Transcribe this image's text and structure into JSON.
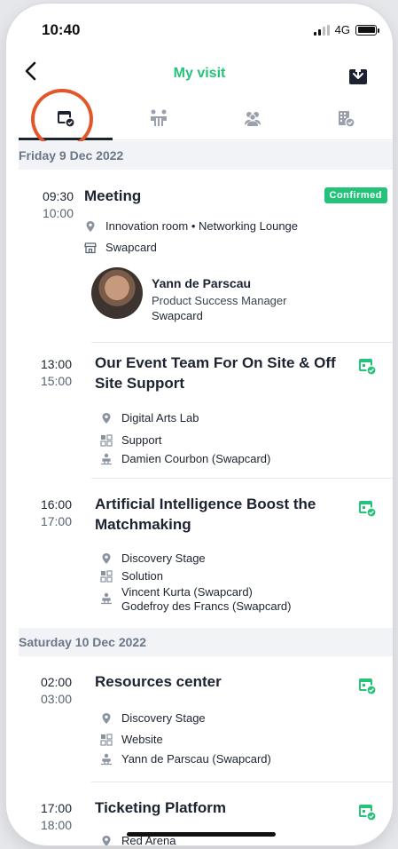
{
  "status": {
    "time": "10:40",
    "network": "4G"
  },
  "header": {
    "title": "My visit"
  },
  "colors": {
    "accent": "#23c37a",
    "highlight": "#e2562a"
  },
  "tabs": [
    {
      "icon": "calendar-check-icon",
      "active": true
    },
    {
      "icon": "meeting-table-icon",
      "active": false
    },
    {
      "icon": "people-icon",
      "active": false
    },
    {
      "icon": "building-check-icon",
      "active": false
    }
  ],
  "days": [
    {
      "label": "Friday 9 Dec 2022",
      "sessions": [
        {
          "start": "09:30",
          "end": "10:00",
          "title": "Meeting",
          "badge": "Confirmed",
          "location": "Innovation room • Networking Lounge",
          "organizer": "Swapcard",
          "person": {
            "name": "Yann de Parscau",
            "role": "Product Success Manager",
            "company": "Swapcard"
          }
        },
        {
          "start": "13:00",
          "end": "15:00",
          "title_line1": "Our Event Team For On Site & Off",
          "title_line2": "Site Support",
          "location": "Digital Arts Lab",
          "category": "Support",
          "speakers": [
            "Damien Courbon (Swapcard)"
          ]
        },
        {
          "start": "16:00",
          "end": "17:00",
          "title_line1": "Artificial Intelligence Boost the",
          "title_line2": "Matchmaking",
          "location": "Discovery Stage",
          "category": "Solution",
          "speakers": [
            "Vincent Kurta (Swapcard)",
            "Godefroy des Francs (Swapcard)"
          ]
        }
      ]
    },
    {
      "label": "Saturday 10 Dec 2022",
      "sessions": [
        {
          "start": "02:00",
          "end": "03:00",
          "title": "Resources center",
          "location": "Discovery Stage",
          "category": "Website",
          "speakers": [
            "Yann de Parscau (Swapcard)"
          ]
        },
        {
          "start": "17:00",
          "end": "18:00",
          "title": "Ticketing Platform",
          "location": "Red Arena"
        }
      ]
    }
  ]
}
